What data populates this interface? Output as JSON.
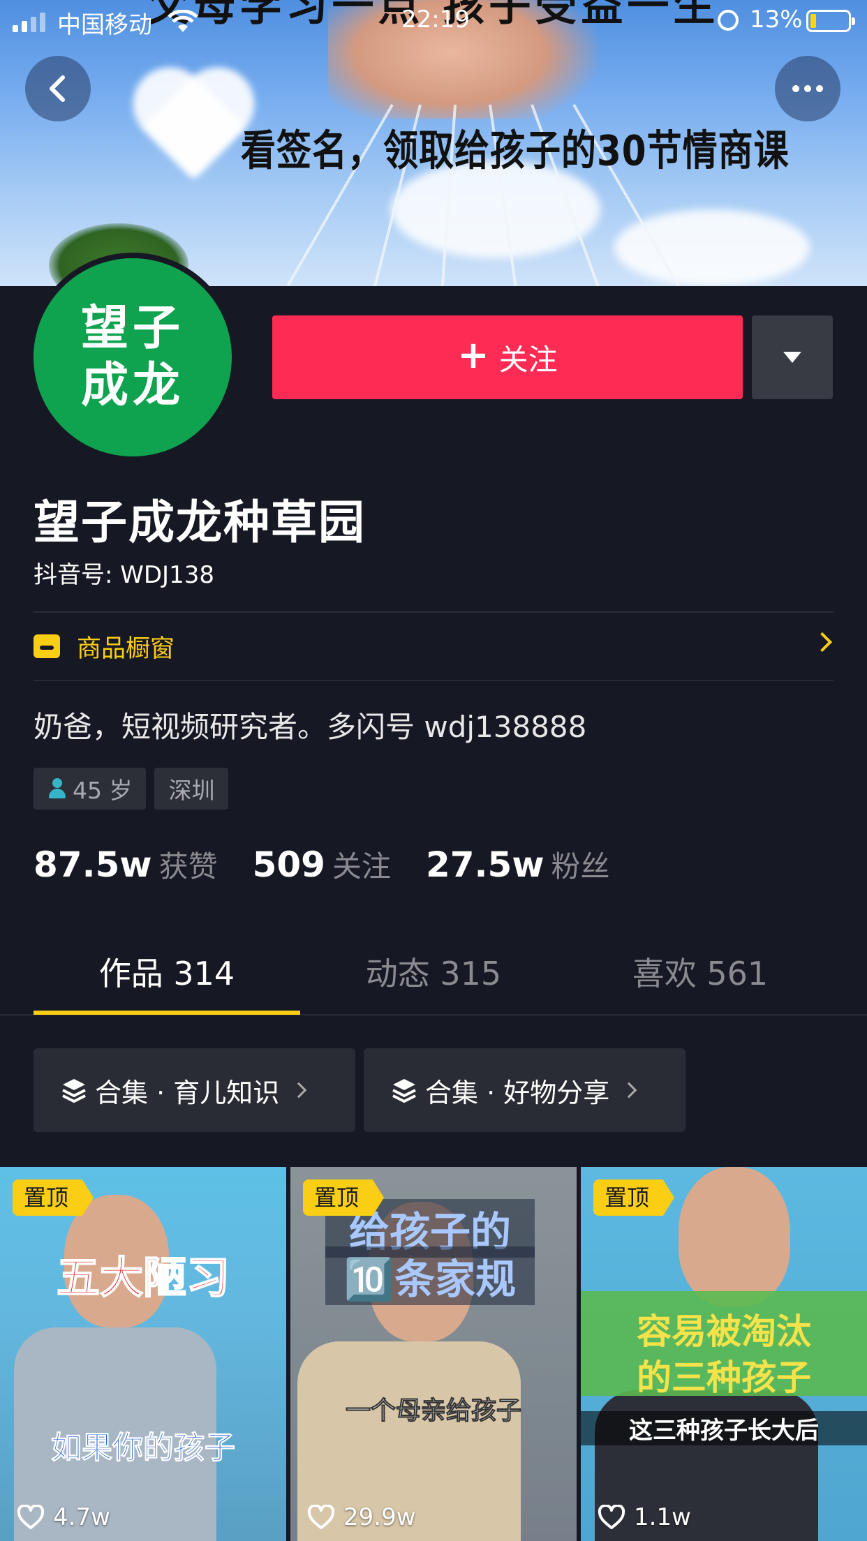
{
  "status_bar": {
    "carrier": "中国移动",
    "time": "22:19",
    "battery": "13%"
  },
  "banner": {
    "top_text": "父母学习一点 孩子受益一生",
    "subtitle": "看签名，领取给孩子的30节情商课"
  },
  "profile": {
    "avatar_line1": "望子",
    "avatar_line2": "成龙",
    "follow_label": "关注",
    "name": "望子成龙种草园",
    "douyin_id": "抖音号: WDJ138",
    "shop_label": "商品橱窗",
    "bio": "奶爸，短视频研究者。多闪号 wdj138888",
    "tags": {
      "age": "45 岁",
      "city": "深圳"
    }
  },
  "stats": [
    {
      "num": "87.5w",
      "label": "获赞"
    },
    {
      "num": "509",
      "label": "关注"
    },
    {
      "num": "27.5w",
      "label": "粉丝"
    }
  ],
  "tabs": [
    {
      "label": "作品 314"
    },
    {
      "label": "动态 315"
    },
    {
      "label": "喜欢 561"
    }
  ],
  "collections": [
    {
      "label": "合集 · 育儿知识"
    },
    {
      "label": "合集 · 好物分享"
    }
  ],
  "videos": [
    {
      "pin": "置顶",
      "cap1": "五大陋习",
      "cap2": "如果你的孩子",
      "likes": "4.7w"
    },
    {
      "pin": "置顶",
      "cap1": "给孩子的",
      "cap2": "🔟条家规",
      "cap3": "一个母亲给孩子",
      "likes": "29.9w"
    },
    {
      "pin": "置顶",
      "cap1": "容易被淘汰",
      "cap2": "的三种孩子",
      "cap3": "这三种孩子长大后",
      "likes": "1.1w"
    }
  ],
  "colors": {
    "background": "#161823",
    "follow": "#fe2c55",
    "accent": "#face15"
  }
}
